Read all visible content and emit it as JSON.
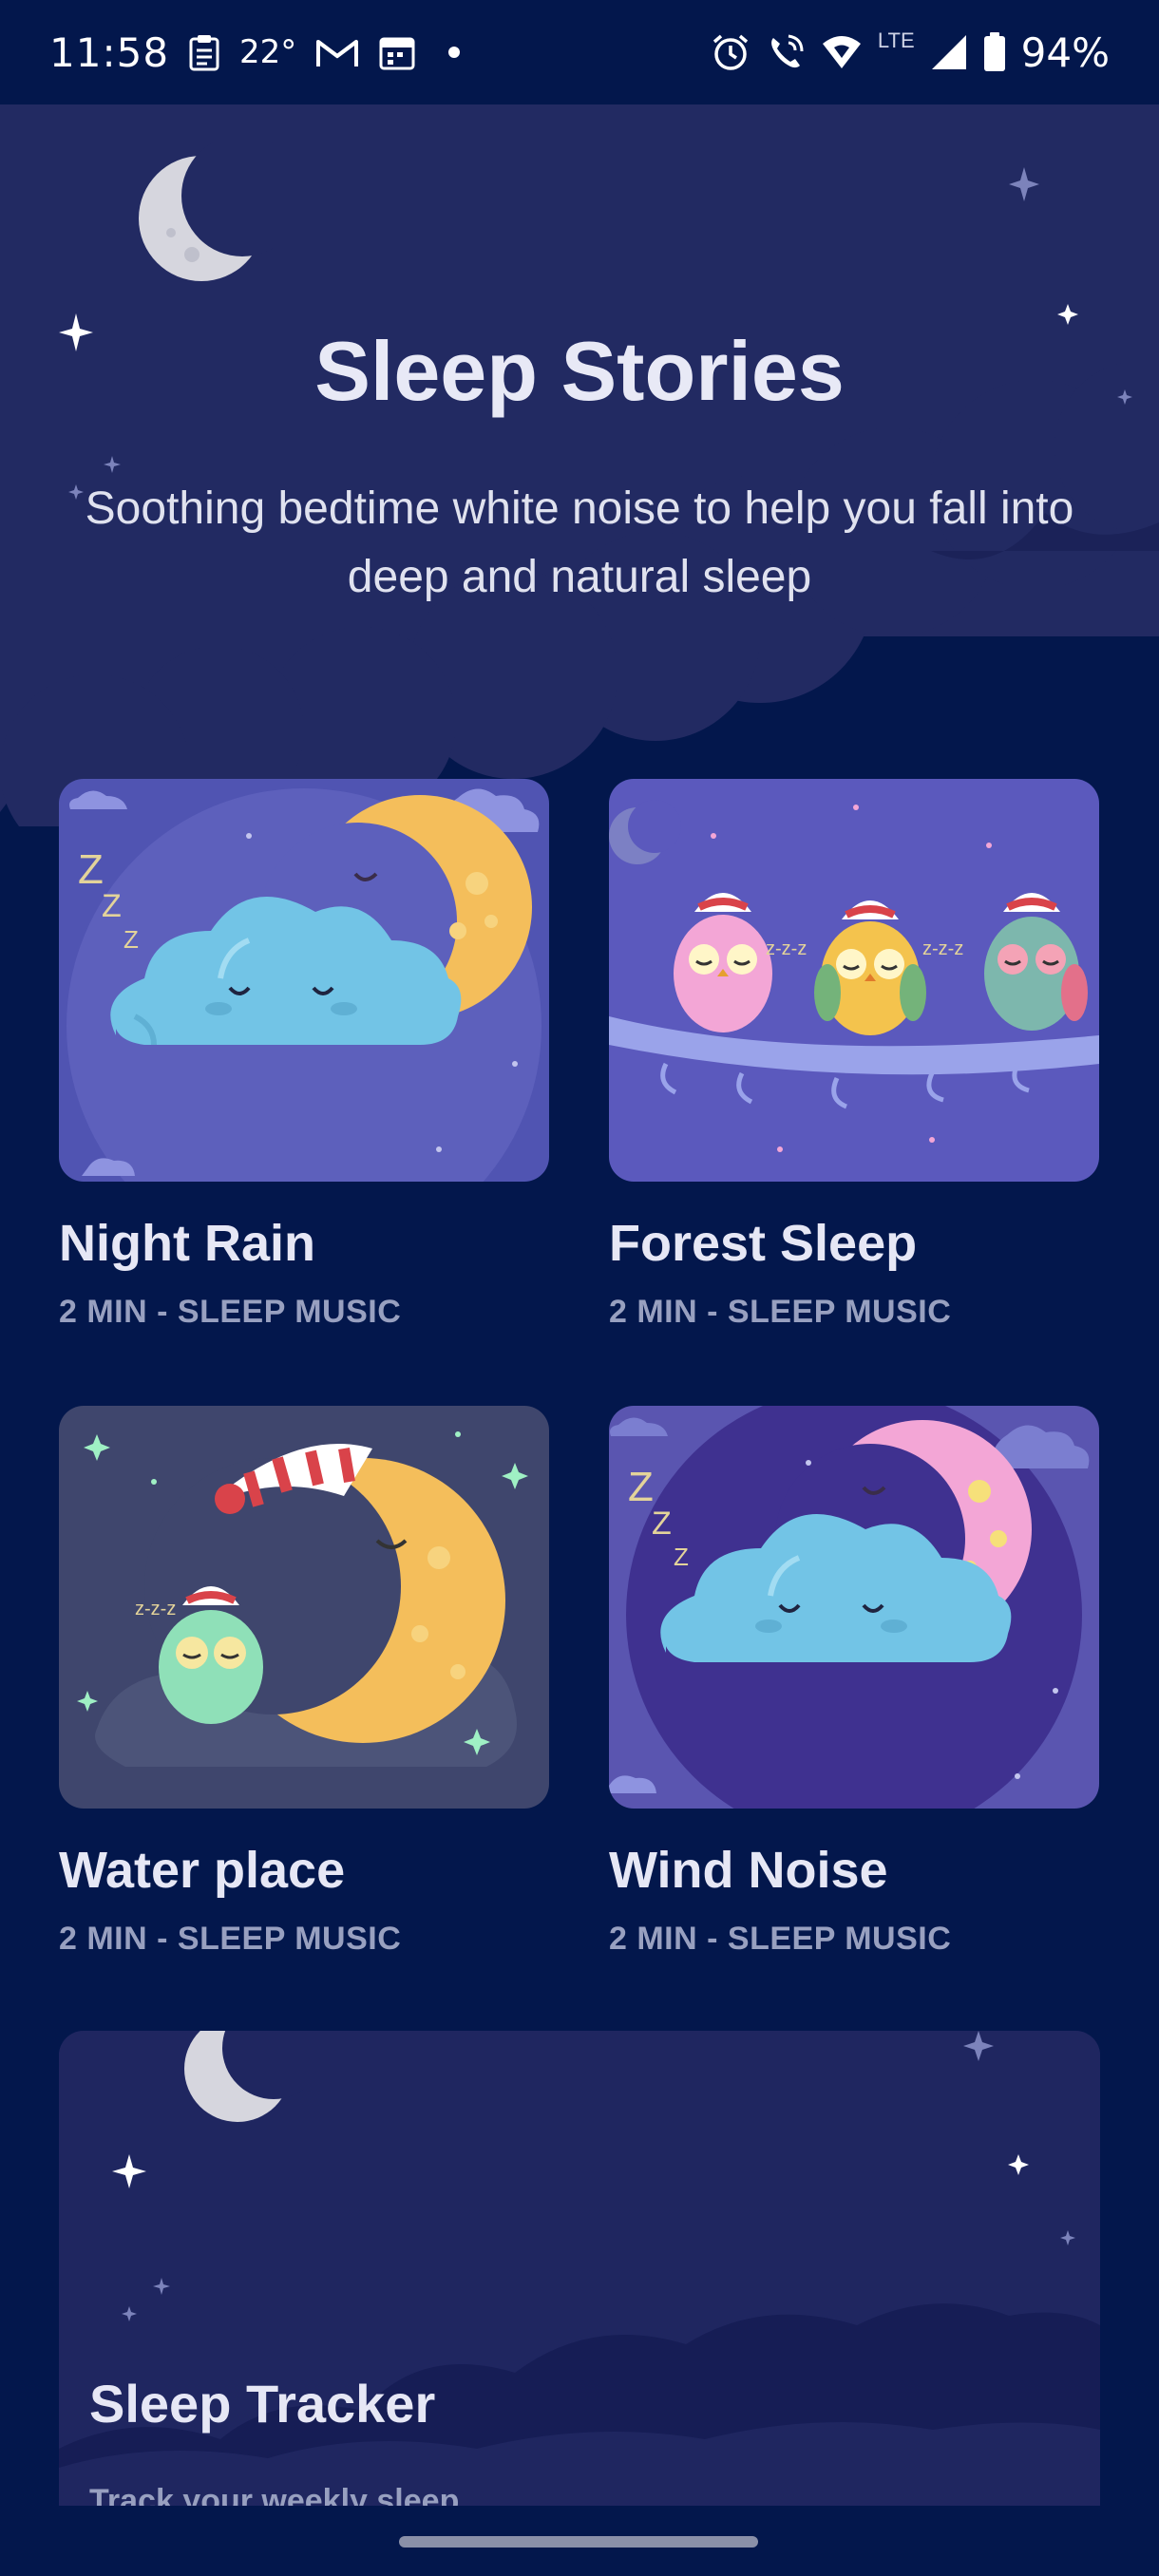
{
  "status_bar": {
    "time": "11:58",
    "temperature": "22°",
    "battery": "94%",
    "network": "LTE"
  },
  "hero": {
    "title": "Sleep Stories",
    "subtitle": "Soothing bedtime white noise to help you fall into deep and natural sleep"
  },
  "cards": [
    {
      "title": "Night Rain",
      "meta": "2 MIN - SLEEP MUSIC"
    },
    {
      "title": "Forest Sleep",
      "meta": "2 MIN - SLEEP MUSIC"
    },
    {
      "title": "Water place",
      "meta": "2 MIN - SLEEP MUSIC"
    },
    {
      "title": "Wind Noise",
      "meta": "2 MIN - SLEEP MUSIC"
    }
  ],
  "tracker": {
    "title": "Sleep Tracker",
    "subtitle": "Track your weekly sleep"
  },
  "colors": {
    "background": "#03174c",
    "hero": "#222a62",
    "moon": "#d6d6de",
    "text": "#e6e7f5",
    "muted": "#98a0c0"
  }
}
